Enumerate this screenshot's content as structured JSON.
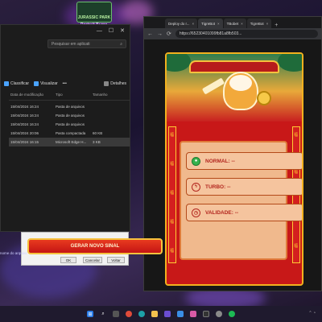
{
  "wallpaper": {
    "sign_text": "JURASSIC PARK",
    "label": "Portrait Bump"
  },
  "explorer": {
    "search_placeholder": "Pesquisar em aplicati",
    "toolbar": {
      "sort": "Classificar",
      "view": "Visualizar",
      "more": "•••",
      "details": "Detalhes"
    },
    "columns": {
      "date": "Data de modificação",
      "type": "Tipo",
      "size": "Tamanho"
    },
    "rows": [
      {
        "date": "15/04/2024 16:24",
        "type": "Pasta de arquivos",
        "size": ""
      },
      {
        "date": "15/04/2024 16:24",
        "type": "Pasta de arquivos",
        "size": ""
      },
      {
        "date": "15/04/2024 16:24",
        "type": "Pasta de arquivos",
        "size": ""
      },
      {
        "date": "15/04/2024 20:06",
        "type": "Pasta compactada",
        "size": "60 KB"
      },
      {
        "date": "15/04/2024 16:15",
        "type": "Microsoft Edge H...",
        "size": "3 KB"
      }
    ],
    "selected_row": 4
  },
  "dialog": {
    "ok": "OK",
    "cancel": "Cancelar",
    "back": "Voltar"
  },
  "left_note": "nome do arquivo",
  "browser": {
    "tabs": [
      {
        "label": "Deploy do r...",
        "active": false
      },
      {
        "label": "TigreBot",
        "active": true
      },
      {
        "label": "TBobet",
        "active": false
      },
      {
        "label": "TigreBot",
        "active": false
      }
    ],
    "address": "https://65230401099fb81a8fb503...",
    "nav": {
      "back": "←",
      "forward": "→",
      "reload": "⟳"
    }
  },
  "game": {
    "normal_label": "NORMAL: --",
    "turbo_label": "TURBO: --",
    "validity_label": "VALIDADE: --",
    "generate_button": "GERAR NOVO SINAL",
    "pillar_chars": [
      "福",
      "福",
      "福",
      "福",
      "福",
      "福",
      "福",
      "福",
      "福"
    ]
  },
  "colors": {
    "frame_red": "#c81818",
    "gold": "#f2b11e",
    "panel_bg": "#f0b98d",
    "label_red": "#b3261e",
    "button_red": "#e83a1f"
  },
  "taskbar": {
    "apps": [
      "windows-icon",
      "search-icon",
      "task-view-icon",
      "chrome-icon",
      "edge-icon",
      "explorer-icon",
      "store-icon",
      "mail-icon",
      "photos-icon",
      "terminal-icon",
      "settings-icon",
      "spotify-icon"
    ]
  }
}
